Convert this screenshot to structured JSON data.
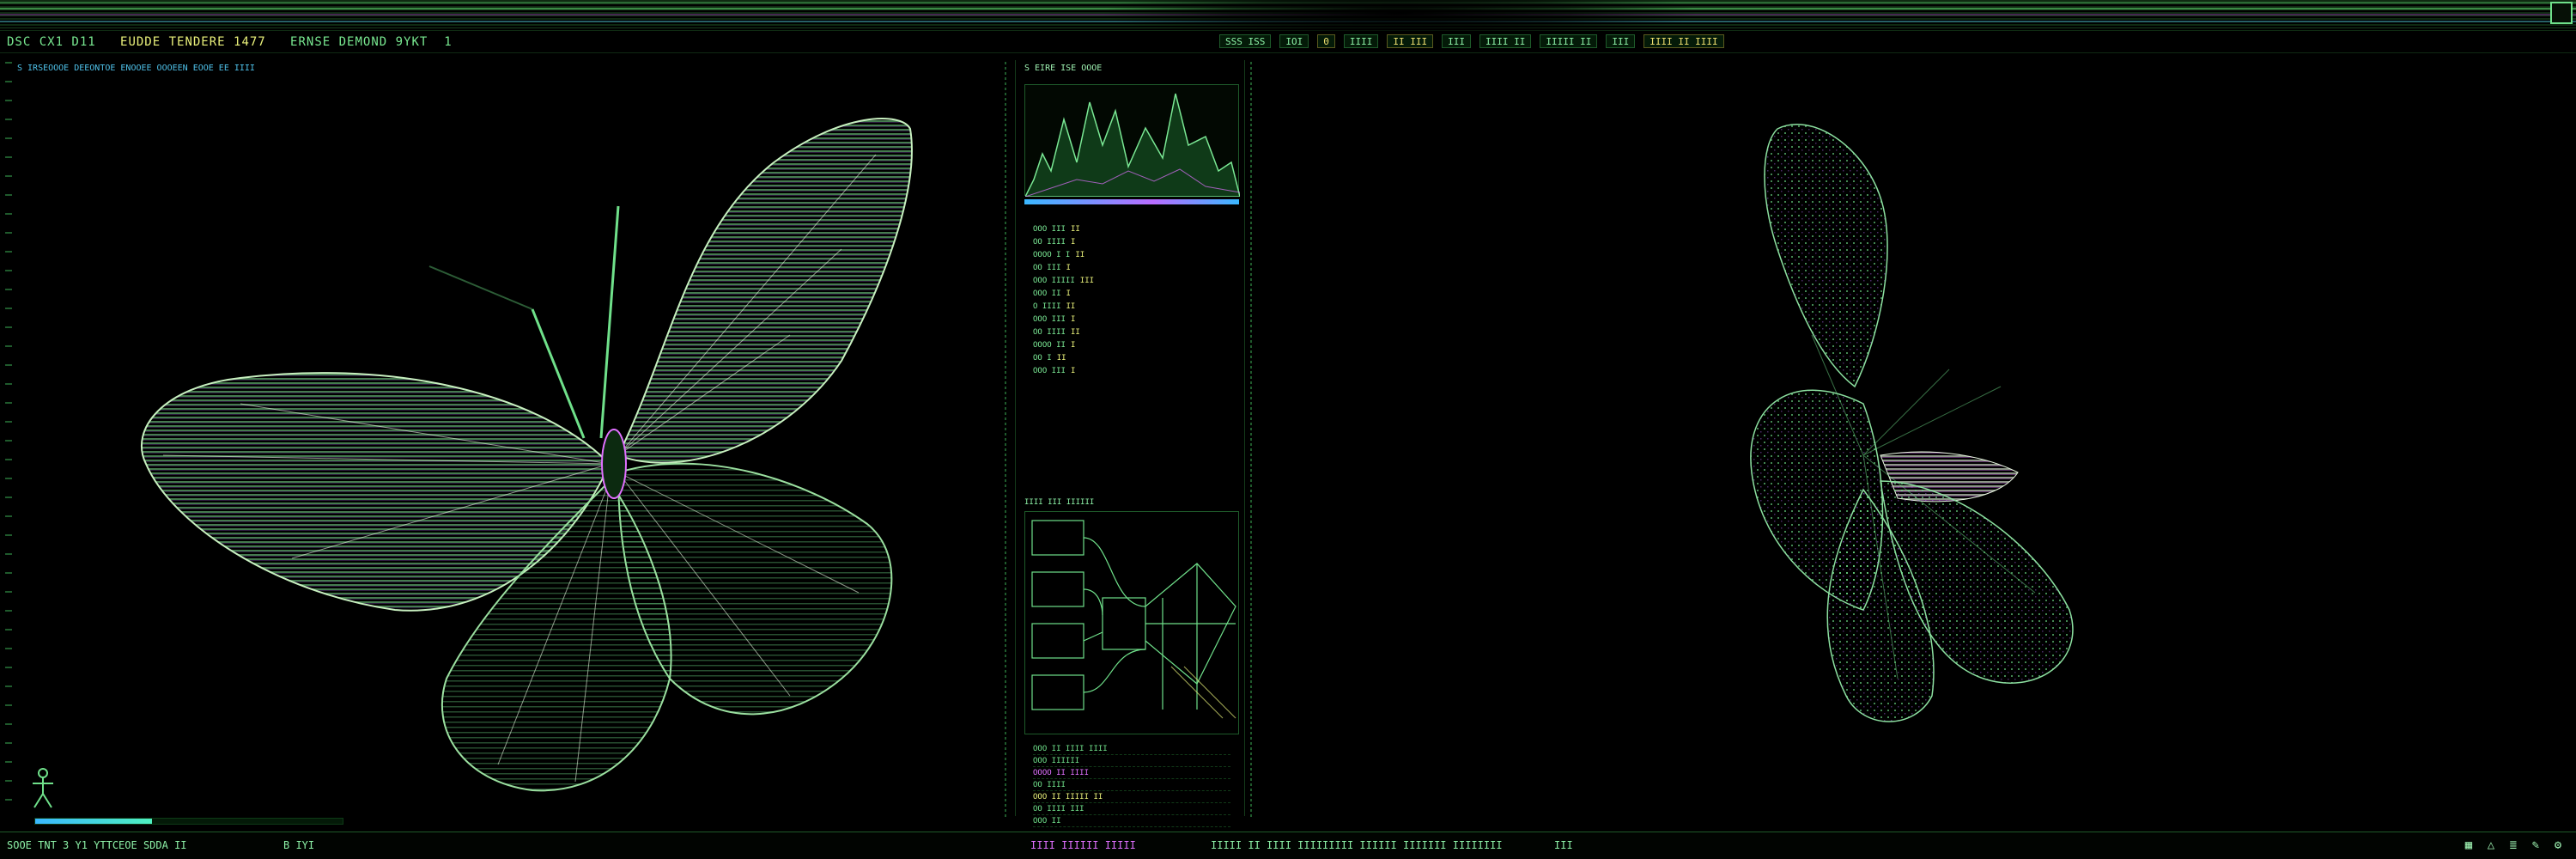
{
  "window": {
    "title_segments": [
      "DSC CX1 D11",
      "EUDDE TENDERE 1477",
      "ERNSE DEMOND 9YKT",
      "1"
    ]
  },
  "toolbar": {
    "items": [
      "SSS ISS",
      "IOI",
      "0",
      "IIII",
      "II III",
      "III",
      "IIII II",
      "IIIII II",
      "III",
      "IIII II IIII"
    ]
  },
  "breadcrumb": "S  IRSEOOOE DEEONTOE ENOOEE OOOEEN  EOOE EE  IIII",
  "inspector": {
    "header": "S  EIRE ISE OOOE",
    "properties": [
      {
        "label": "OOO III",
        "value": "II"
      },
      {
        "label": "OO IIII",
        "value": "I"
      },
      {
        "label": "OOOO I I",
        "value": "II"
      },
      {
        "label": "OO III",
        "value": "I"
      },
      {
        "label": "OOO IIIII",
        "value": "III"
      },
      {
        "label": "OOO II",
        "value": "I"
      },
      {
        "label": "O IIII",
        "value": "II"
      },
      {
        "label": "OOO III",
        "value": "I"
      },
      {
        "label": "OO IIII",
        "value": "II"
      },
      {
        "label": "OOOO II",
        "value": "I"
      },
      {
        "label": "OO I",
        "value": "II"
      },
      {
        "label": "OOO III",
        "value": "I"
      }
    ],
    "node_header": "IIII III IIIIII",
    "layers": [
      "OOO II IIII IIII",
      "OOO IIIIII",
      "OOOO II IIII",
      "OO IIII",
      "OOO II IIIII II",
      "OO IIII III",
      "OOO II"
    ]
  },
  "progress": {
    "value": 0.38
  },
  "status": {
    "left": "SOOE TNT 3 Y1 YTTCEOE  SDDA  II",
    "zoom": "B  IYI",
    "mid_a": "IIII  IIIIII IIIII",
    "mid_b": "IIIII  II  IIII IIIIIIIII IIIIII IIIIIII  IIIIIIII",
    "right": "III"
  },
  "status_icons": [
    "grid-icon",
    "triangle-icon",
    "layers-icon",
    "brush-icon",
    "settings-icon"
  ],
  "colors": {
    "accent_green": "#6fe08a",
    "accent_magenta": "#e070ff",
    "accent_cyan": "#3ab8ff",
    "accent_yellow": "#e9f07a"
  }
}
